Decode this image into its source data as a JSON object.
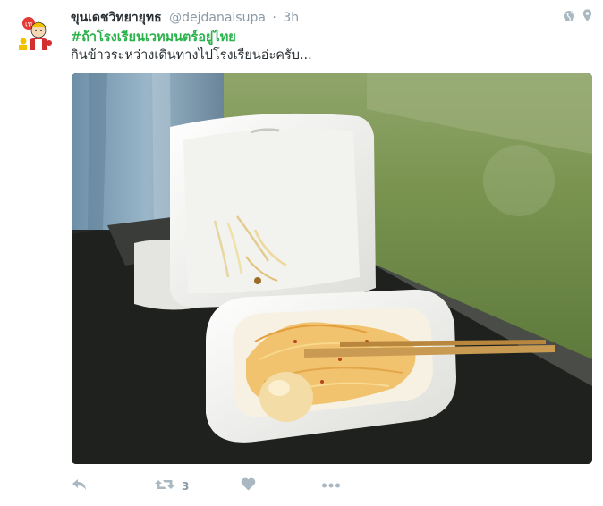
{
  "tweet": {
    "author_name": "ขุนเดชวิทยายุทธ",
    "handle": "@dejdanaisupa",
    "separator": "·",
    "time": "3h",
    "hashtag": "#ถ้าโรงเรียนเวทมนตร์อยู่ไทย",
    "text": "กินข้าวระหว่างเดินทางไปโรงเรียนอ่ะครับ..."
  },
  "avatar": {
    "badge_text": "เท"
  },
  "header_icons": [
    "globe-icon",
    "location-pin-icon"
  ],
  "actions": {
    "reply_icon": "reply-icon",
    "retweet_icon": "retweet-icon",
    "retweet_count": "3",
    "like_icon": "heart-icon",
    "more_icon": "more-dots-icon"
  },
  "colors": {
    "name": "#292f33",
    "meta": "#8899a6",
    "hashtag": "#2ab24b",
    "action_icons": "#aab8c2"
  }
}
